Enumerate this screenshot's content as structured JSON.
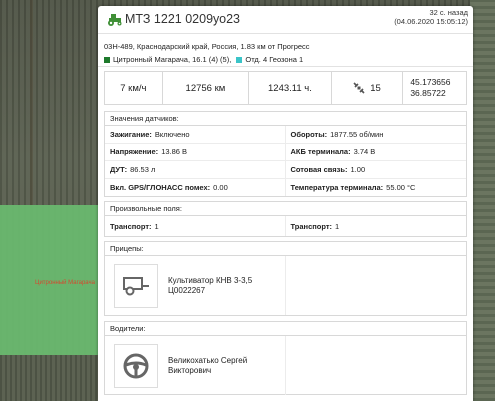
{
  "map": {
    "label": "Цитронный Магарача"
  },
  "header": {
    "title": "МТЗ 1221 0209уо23",
    "ago": "32 с. назад",
    "datetime": "(04.06.2020 15:05:12)"
  },
  "location": {
    "address": "03Н-489, Краснодарский край, Россия, 1.83 км от Прогресс",
    "geofence1": "Цитронный Магарача, 16.1 (4) (5),",
    "geofence2": "Отд. 4 Геозона 1"
  },
  "stats": {
    "speed": "7 км/ч",
    "odometer": "12756 км",
    "engine_hours": "1243.11 ч.",
    "satellites": "15",
    "lat": "45.173656",
    "lon": "36.85722"
  },
  "sensors": {
    "title": "Значения датчиков:",
    "rows": [
      {
        "l_label": "Зажигание:",
        "l_value": "Включено",
        "r_label": "Обороты:",
        "r_value": "1877.55 об/мин"
      },
      {
        "l_label": "Напряжение:",
        "l_value": "13.86 В",
        "r_label": "АКБ терминала:",
        "r_value": "3.74 В"
      },
      {
        "l_label": "ДУТ:",
        "l_value": "86.53 л",
        "r_label": "Сотовая связь:",
        "r_value": "1.00"
      },
      {
        "l_label": "Вкл. GPS/ГЛОНАСС помех:",
        "l_value": "0.00",
        "r_label": "Температура терминала:",
        "r_value": "55.00 °C"
      }
    ]
  },
  "custom_fields": {
    "title": "Произвольные поля:",
    "l_label": "Транспорт:",
    "l_value": "1",
    "r_label": "Транспорт:",
    "r_value": "1"
  },
  "trailers": {
    "title": "Прицепы:",
    "name_line1": "Культиватор КНВ 3-3,5",
    "name_line2": "Ц0022267"
  },
  "drivers": {
    "title": "Водители:",
    "name_line1": "Великохатько Сергей",
    "name_line2": "Викторович"
  },
  "colors": {
    "geofence1": "#1e7a2c",
    "geofence2": "#3bc4c8",
    "tractor": "#3f8f36"
  }
}
